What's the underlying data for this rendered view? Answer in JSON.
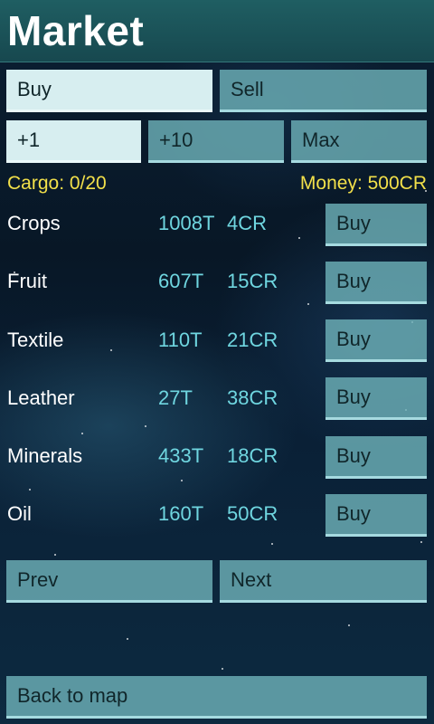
{
  "header": {
    "title": "Market"
  },
  "mode_tabs": {
    "buy_label": "Buy",
    "sell_label": "Sell",
    "selected": "Buy"
  },
  "quantity_tabs": {
    "plus1_label": "+1",
    "plus10_label": "+10",
    "max_label": "Max",
    "selected": "+1"
  },
  "status": {
    "cargo": "Cargo: 0/20",
    "money": "Money: 500CR"
  },
  "goods": [
    {
      "name": "Crops",
      "quantity": "1008T",
      "price": "4CR",
      "action_label": "Buy"
    },
    {
      "name": "Fruit",
      "quantity": "607T",
      "price": "15CR",
      "action_label": "Buy"
    },
    {
      "name": "Textile",
      "quantity": "110T",
      "price": "21CR",
      "action_label": "Buy"
    },
    {
      "name": "Leather",
      "quantity": "27T",
      "price": "38CR",
      "action_label": "Buy"
    },
    {
      "name": "Minerals",
      "quantity": "433T",
      "price": "18CR",
      "action_label": "Buy"
    },
    {
      "name": "Oil",
      "quantity": "160T",
      "price": "50CR",
      "action_label": "Buy"
    }
  ],
  "pagination": {
    "prev_label": "Prev",
    "next_label": "Next"
  },
  "footer": {
    "back_label": "Back to map"
  },
  "colors": {
    "header_background": "#1f5e62",
    "button": "#6db0b7",
    "button_selected": "#d7eef0",
    "status_text": "#f2e04a",
    "goods_values": "#6fd6e0"
  }
}
